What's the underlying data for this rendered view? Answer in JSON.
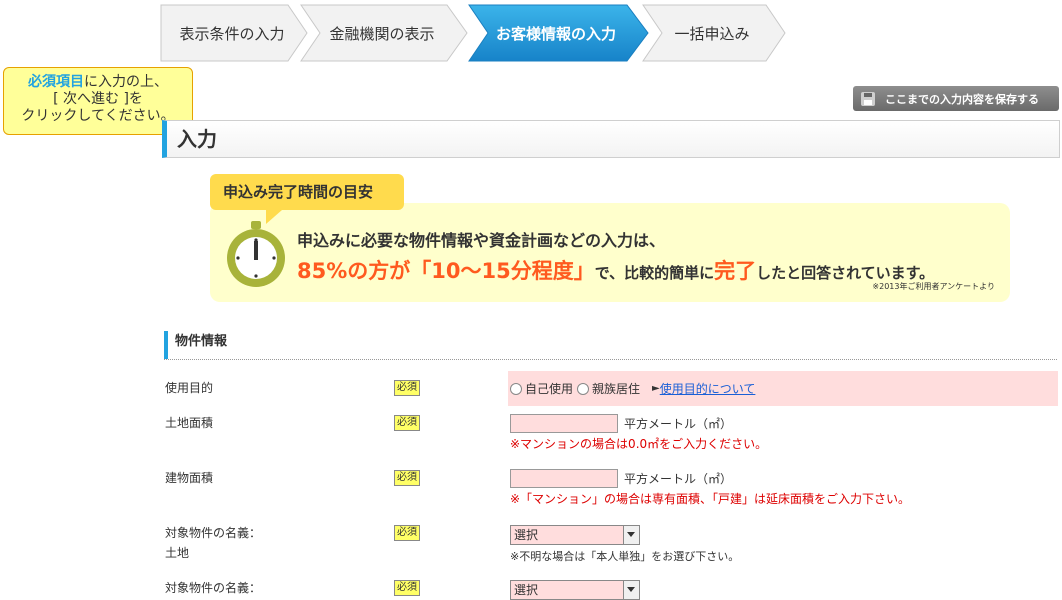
{
  "steps": [
    {
      "label": "表示条件の入力",
      "active": false
    },
    {
      "label": "金融機関の表示",
      "active": false
    },
    {
      "label": "お客様情報の入力",
      "active": true
    },
    {
      "label": "一括申込み",
      "active": false
    }
  ],
  "tooltip": {
    "emphasis": "必須項目",
    "line1_rest": "に入力の上、",
    "line2": "[ 次へ進む ]を",
    "line3": "クリックしてください。"
  },
  "save_button": {
    "label": "ここまでの入力内容を保存する",
    "icon": "floppy-disk-icon"
  },
  "section_title": "入力",
  "notice": {
    "tag": "申込み完了時間の目安",
    "line1": "申込みに必要な物件情報や資金計画などの入力は、",
    "line2_part1": "85%の方が「10～15分程度」",
    "line2_part2": "で、比較的簡単に",
    "line2_part3": "完了",
    "line2_part4": "したと回答されています。",
    "source": "※2013年ご利用者アンケートより",
    "icon": "stopwatch-icon"
  },
  "form": {
    "subtitle": "物件情報",
    "required_label": "必須",
    "rows": {
      "purpose": {
        "label": "使用目的",
        "option1": "自己使用",
        "option2": "親族居住",
        "link_prefix": "►",
        "link": "使用目的について"
      },
      "land_area": {
        "label": "土地面積",
        "unit": "平方メートル（㎡）",
        "warning": "※マンションの場合は0.0㎡をご入力ください。"
      },
      "building_area": {
        "label": "建物面積",
        "unit": "平方メートル（㎡）",
        "warning": "※「マンション」の場合は専有面積、「戸建」は延床面積をご入力下さい。"
      },
      "owner_land": {
        "label_line1": "対象物件の名義：",
        "label_line2": "土地",
        "select_value": "選択",
        "note": "※不明な場合は「本人単独」をお選び下さい。"
      },
      "owner_building": {
        "label_line1": "対象物件の名義：",
        "select_value": "選択"
      }
    }
  },
  "colors": {
    "accent_blue": "#22a3e0",
    "required_bg": "#ffff66",
    "input_bg": "#ffdddd",
    "warning_red": "#dd0000",
    "highlight_orange": "#ff5a1f"
  }
}
